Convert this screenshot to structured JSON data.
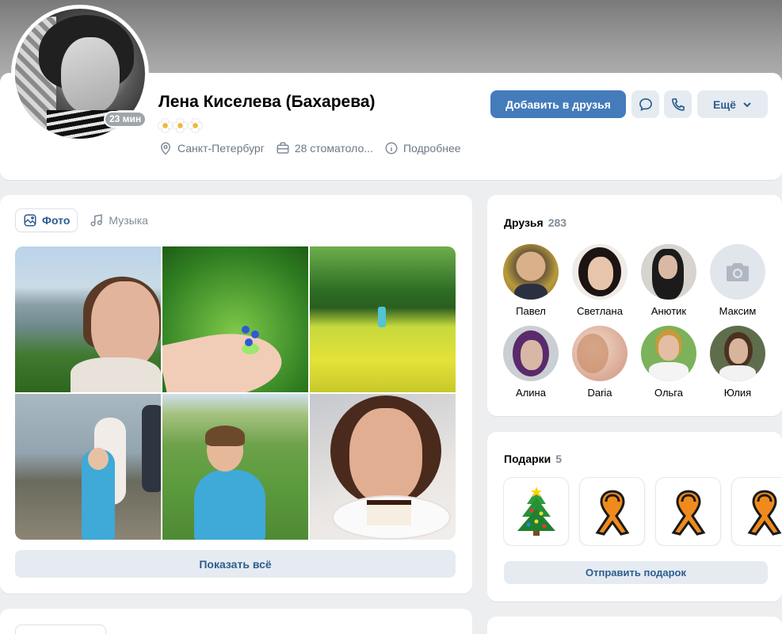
{
  "profile": {
    "name": "Лена Киселева (Бахарева)",
    "online_status": "23 мин",
    "location": "Санкт-Петербург",
    "work": "28 стоматоло...",
    "details_label": "Подробнее"
  },
  "actions": {
    "add_friend_label": "Добавить в друзья",
    "more_label": "Ещё"
  },
  "photos": {
    "tabs": [
      {
        "label": "Фото",
        "active": true
      },
      {
        "label": "Музыка",
        "active": false
      }
    ],
    "show_all_label": "Показать всё"
  },
  "friends": {
    "title": "Друзья",
    "count": "283",
    "items": [
      {
        "name": "Павел"
      },
      {
        "name": "Светлана"
      },
      {
        "name": "Анютик"
      },
      {
        "name": "Максим"
      },
      {
        "name": "Алина"
      },
      {
        "name": "Daria"
      },
      {
        "name": "Ольга"
      },
      {
        "name": "Юлия"
      }
    ]
  },
  "gifts": {
    "title": "Подарки",
    "count": "5",
    "send_label": "Отправить подарок"
  },
  "colors": {
    "accent": "#447bba",
    "link": "#2c5d8f",
    "secondary_button": "#e5ebf1",
    "muted_text": "#818c99"
  }
}
